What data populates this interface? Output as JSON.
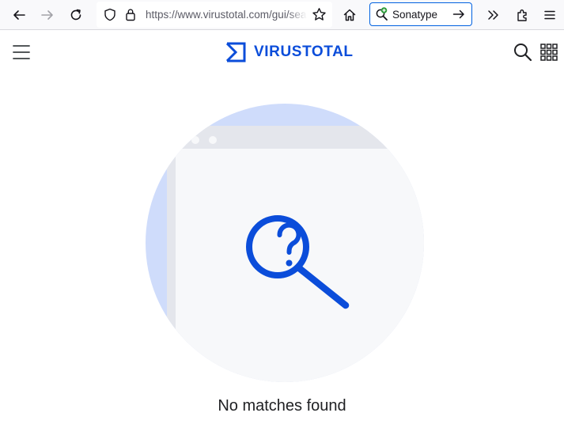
{
  "browser": {
    "url": "https://www.virustotal.com/gui/search",
    "search_engine_label": "Sonatype",
    "icons": {
      "back": "back-arrow-icon",
      "forward": "forward-arrow-icon",
      "reload": "reload-icon",
      "tracking": "shield-icon",
      "lock": "lock-icon",
      "bookmark": "star-icon",
      "home": "home-icon",
      "search_engine": "magnifier-plus-icon",
      "go": "arrow-right-icon",
      "overflow": "double-chevron-icon",
      "extensions": "puzzle-icon",
      "menu": "hamburger-icon"
    }
  },
  "header": {
    "logo_text": "VIRUSTOTAL",
    "brand_color": "#0b4dda",
    "icons": {
      "menu": "hamburger-icon",
      "search": "search-icon",
      "apps": "apps-grid-icon"
    }
  },
  "main": {
    "empty_state_message": "No matches found",
    "illustration": "magnifier-question-icon"
  }
}
